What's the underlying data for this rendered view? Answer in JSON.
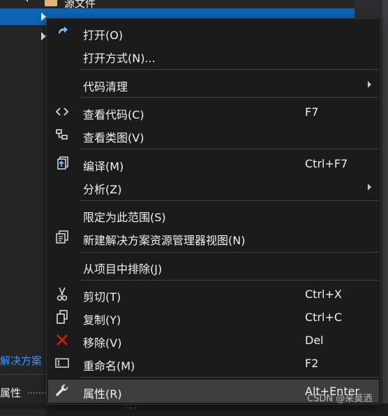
{
  "background": {
    "tree_top_label": "源文件",
    "solution_tab": "解决方案",
    "properties_tab": "属性",
    "bottom_clip_text": "ᐧ ᐧ ᐧ"
  },
  "menu": {
    "items": [
      {
        "label": "打开(O)",
        "shortcut": "",
        "icon": "open-redo-icon"
      },
      {
        "label": "打开方式(N)...",
        "shortcut": "",
        "icon": ""
      },
      {
        "label": "代码清理",
        "shortcut": "",
        "icon": "",
        "submenu": true
      },
      {
        "label": "查看代码(C)",
        "shortcut": "F7",
        "icon": "code-brackets-icon"
      },
      {
        "label": "查看类图(V)",
        "shortcut": "",
        "icon": "class-diagram-icon"
      },
      {
        "label": "编译(M)",
        "shortcut": "Ctrl+F7",
        "icon": "compile-icon"
      },
      {
        "label": "分析(Z)",
        "shortcut": "",
        "icon": "",
        "submenu": true
      },
      {
        "label": "限定为此范围(S)",
        "shortcut": "",
        "icon": ""
      },
      {
        "label": "新建解决方案资源管理器视图(N)",
        "shortcut": "",
        "icon": "new-view-icon"
      },
      {
        "label": "从项目中排除(J)",
        "shortcut": "",
        "icon": ""
      },
      {
        "label": "剪切(T)",
        "shortcut": "Ctrl+X",
        "icon": "cut-icon"
      },
      {
        "label": "复制(Y)",
        "shortcut": "Ctrl+C",
        "icon": "copy-icon"
      },
      {
        "label": "移除(V)",
        "shortcut": "Del",
        "icon": "remove-icon"
      },
      {
        "label": "重命名(M)",
        "shortcut": "F2",
        "icon": "rename-icon"
      },
      {
        "label": "属性(R)",
        "shortcut": "Alt+Enter",
        "icon": "wrench-icon"
      }
    ]
  },
  "watermark": "CSDN @来莫洒",
  "colors": {
    "menu_bg": "#1b1b1c",
    "selection_blue": "#0e63b4",
    "remove_red": "#e51400",
    "open_blue": "#75beff",
    "link_blue": "#3794ff"
  }
}
